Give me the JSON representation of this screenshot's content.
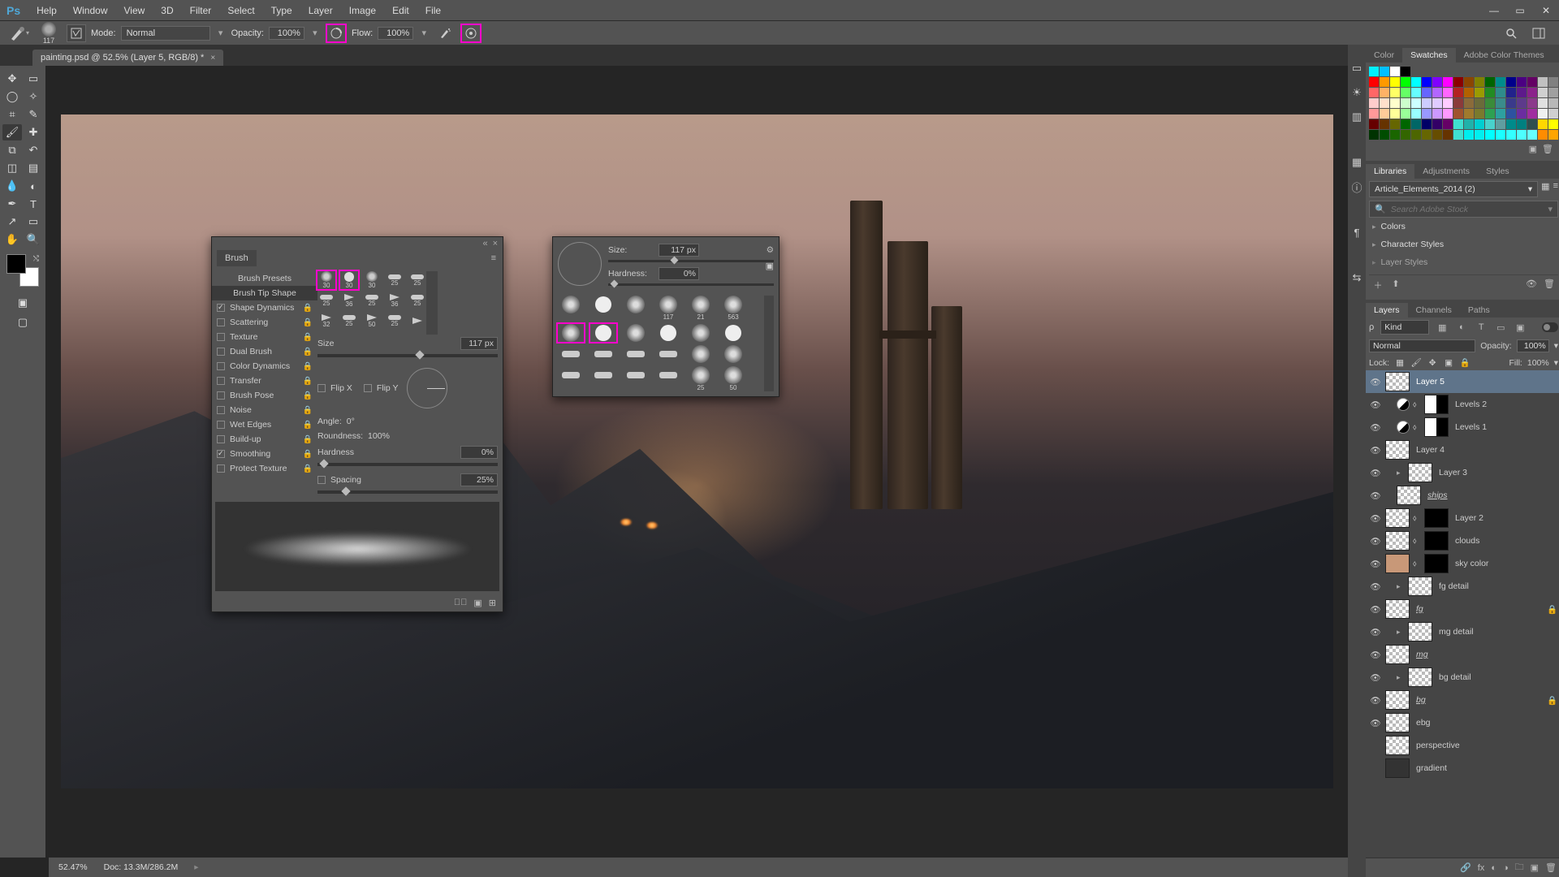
{
  "app": {
    "logo": "Ps"
  },
  "menu": [
    "File",
    "Edit",
    "Image",
    "Layer",
    "Type",
    "Select",
    "Filter",
    "3D",
    "View",
    "Window",
    "Help"
  ],
  "window_controls": {
    "min": "—",
    "max": "▭",
    "close": "✕"
  },
  "options": {
    "brush_size_preview": "117",
    "mode_label": "Mode:",
    "mode_value": "Normal",
    "opacity_label": "Opacity:",
    "opacity_value": "100%",
    "flow_label": "Flow:",
    "flow_value": "100%"
  },
  "document_tab": {
    "title": "painting.psd @ 52.5% (Layer 5, RGB/8) *"
  },
  "status": {
    "zoom": "52.47%",
    "doc_info": "Doc: 13.3M/286.2M"
  },
  "brush_panel": {
    "title": "Brush",
    "presets_label": "Brush Presets",
    "tip_shape_label": "Brush Tip Shape",
    "options": [
      {
        "label": "Shape Dynamics",
        "checked": true
      },
      {
        "label": "Scattering",
        "checked": false
      },
      {
        "label": "Texture",
        "checked": false
      },
      {
        "label": "Dual Brush",
        "checked": false
      },
      {
        "label": "Color Dynamics",
        "checked": false
      },
      {
        "label": "Transfer",
        "checked": false
      },
      {
        "label": "Brush Pose",
        "checked": false
      },
      {
        "label": "Noise",
        "checked": false
      },
      {
        "label": "Wet Edges",
        "checked": false
      },
      {
        "label": "Build-up",
        "checked": false
      },
      {
        "label": "Smoothing",
        "checked": true
      },
      {
        "label": "Protect Texture",
        "checked": false
      }
    ],
    "tip_grid_labels": [
      "30",
      "30",
      "30",
      "25",
      "25",
      "25",
      "36",
      "25",
      "36",
      "25",
      "32",
      "25",
      "50",
      "25",
      ""
    ],
    "size_label": "Size",
    "size_value": "117 px",
    "flipx": "Flip X",
    "flipy": "Flip Y",
    "angle_label": "Angle:",
    "angle_value": "0°",
    "roundness_label": "Roundness:",
    "roundness_value": "100%",
    "hardness_label": "Hardness",
    "hardness_value": "0%",
    "spacing_label": "Spacing",
    "spacing_value": "25%"
  },
  "brush_picker": {
    "size_label": "Size:",
    "size_value": "117 px",
    "hardness_label": "Hardness:",
    "hardness_value": "0%",
    "grid_labels": [
      "",
      "",
      "",
      "117",
      "21",
      "563",
      "",
      "",
      "",
      "",
      "",
      "",
      "",
      "",
      "",
      "",
      "",
      "",
      "",
      "",
      "",
      "",
      "25",
      "50"
    ]
  },
  "color_panel_tabs": [
    "Color",
    "Swatches",
    "Adobe Color Themes"
  ],
  "swatch_colors": [
    [
      "#00f0ff",
      "#00c0ff",
      "#ffffff",
      "#000000"
    ],
    [
      "#ff0000",
      "#ff9900",
      "#ffff00",
      "#00ff00",
      "#00ffff",
      "#0000ff",
      "#8000ff",
      "#ff00ff",
      "#8b0000",
      "#8b4500",
      "#808000",
      "#006400",
      "#008b8b",
      "#00008b",
      "#4b0082",
      "#640064",
      "#c0c0c0",
      "#808080"
    ],
    [
      "#ff6666",
      "#ffb266",
      "#ffff66",
      "#66ff66",
      "#66ffff",
      "#6666ff",
      "#b266ff",
      "#ff66ff",
      "#b22222",
      "#b26100",
      "#9b9b00",
      "#228b22",
      "#2f8b8b",
      "#22228b",
      "#5d1a8b",
      "#8b228b",
      "#d0d0d0",
      "#a0a0a0"
    ],
    [
      "#ffcccc",
      "#ffe0cc",
      "#ffffcc",
      "#ccffcc",
      "#ccffff",
      "#ccccff",
      "#e0ccff",
      "#ffccff",
      "#8b3a3a",
      "#8b6b3a",
      "#6b6b3a",
      "#3a8b3a",
      "#3a8b8b",
      "#3a3a8b",
      "#5d3a8b",
      "#8b3a8b",
      "#e0e0e0",
      "#b8b8b8"
    ],
    [
      "#ff9999",
      "#ffcc99",
      "#ffff99",
      "#99ff99",
      "#99ffff",
      "#9999ff",
      "#cc99ff",
      "#ff99ff",
      "#a0522d",
      "#a07a2d",
      "#7a7a2d",
      "#2da052",
      "#2da0a0",
      "#2d52a0",
      "#6b2da0",
      "#a02da0",
      "#f0f0f0",
      "#d0d0d0"
    ],
    [
      "#660000",
      "#663300",
      "#666600",
      "#006600",
      "#006666",
      "#000066",
      "#330066",
      "#660066",
      "#40e0d0",
      "#20b2aa",
      "#00ced1",
      "#48d1cc",
      "#5f9ea0",
      "#008b8b",
      "#008080",
      "#2f4f4f",
      "#ffd700",
      "#ffff00"
    ],
    [
      "#003300",
      "#004d00",
      "#1a6600",
      "#336600",
      "#4d6600",
      "#666600",
      "#664d00",
      "#663300",
      "#40e0d0",
      "#00eeee",
      "#00f0f0",
      "#00ffff",
      "#1affff",
      "#33ffff",
      "#4dffff",
      "#66ffff",
      "#ff8c00",
      "#ffa500"
    ]
  ],
  "libraries": {
    "tabs": [
      "Libraries",
      "Adjustments",
      "Styles"
    ],
    "current": "Article_Elements_2014 (2)",
    "search_placeholder": "Search Adobe Stock",
    "groups": [
      "Colors",
      "Character Styles",
      "Layer Styles"
    ]
  },
  "layers_panel": {
    "tabs": [
      "Layers",
      "Channels",
      "Paths"
    ],
    "kind": "Kind",
    "blend": "Normal",
    "opacity_label": "Opacity:",
    "opacity_value": "100%",
    "lock_label": "Lock:",
    "fill_label": "Fill:",
    "fill_value": "100%",
    "layers": [
      {
        "name": "Layer 5",
        "selected": true,
        "thumb": true
      },
      {
        "name": "Levels 2",
        "adj": true,
        "mask": "half",
        "indent": 1,
        "link": true
      },
      {
        "name": "Levels 1",
        "adj": true,
        "mask": "half",
        "indent": 1,
        "link": true
      },
      {
        "name": "Layer 4",
        "thumb": true
      },
      {
        "name": "Layer 3",
        "thumb": true,
        "indent": 1,
        "caret": true
      },
      {
        "name": "ships",
        "thumb": true,
        "italic": true,
        "indent": 1
      },
      {
        "name": "Layer 2",
        "thumb": true,
        "mask": "black",
        "link": true
      },
      {
        "name": "clouds",
        "thumb": true,
        "mask": "black",
        "link": true
      },
      {
        "name": "sky color",
        "thumb": "color",
        "mask": "black",
        "link": true
      },
      {
        "name": "fg detail",
        "thumb": true,
        "indent": 1,
        "caret": true
      },
      {
        "name": "fg",
        "thumb": true,
        "italic": true,
        "lock": true
      },
      {
        "name": "mg detail",
        "thumb": true,
        "indent": 1,
        "caret": true
      },
      {
        "name": "mg",
        "thumb": true,
        "italic": true
      },
      {
        "name": "bg detail",
        "thumb": true,
        "indent": 1,
        "caret": true
      },
      {
        "name": "bg",
        "thumb": true,
        "italic": true,
        "lock": true
      },
      {
        "name": "ebg",
        "thumb": true
      },
      {
        "name": "perspective",
        "thumb": true,
        "novis": true
      },
      {
        "name": "gradient",
        "thumb": "dark",
        "novis": true
      }
    ]
  }
}
